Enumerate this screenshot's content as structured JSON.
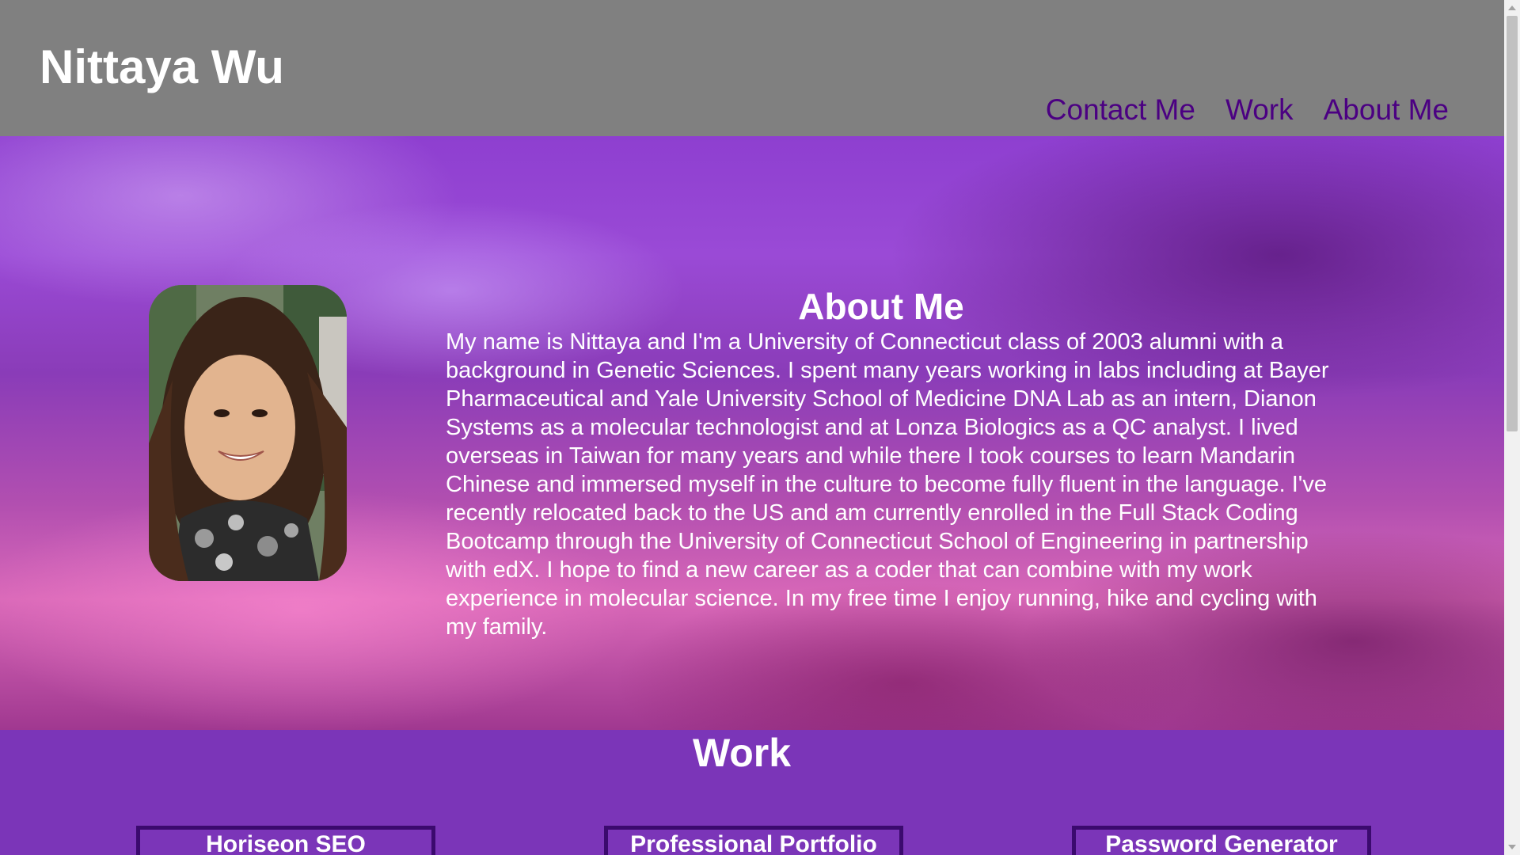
{
  "header": {
    "brand": "Nittaya Wu",
    "nav": [
      "Contact Me",
      "Work",
      "About Me"
    ]
  },
  "about": {
    "title": "About Me",
    "text": "My name is Nittaya and I'm a University of Connecticut class of 2003 alumni with a background in Genetic Sciences. I spent many years working in labs including at Bayer Pharmaceutical and Yale University School of Medicine DNA Lab as an intern, Dianon Systems as a molecular technologist and at Lonza Biologics as a QC analyst. I lived overseas in Taiwan for many years and while there I took courses to learn Mandarin Chinese and immersed myself in the culture to become fully fluent in the language. I've recently relocated back to the US and am currently enrolled in the Full Stack Coding Bootcamp through the University of Connecticut School of Engineering in partnership with edX. I hope to find a new career as a coder that can combine with my work experience in molecular science. In my free time I enjoy running, hike and cycling with my family.",
    "photo": "profile-photo"
  },
  "work": {
    "title": "Work",
    "projects": [
      "Horiseon SEO",
      "Professional Portfolio",
      "Password Generator"
    ]
  },
  "colors": {
    "header_bg": "#808080",
    "nav_link": "#4b0082",
    "work_bg": "#7b35b8",
    "card_border": "#3b0a6e"
  }
}
